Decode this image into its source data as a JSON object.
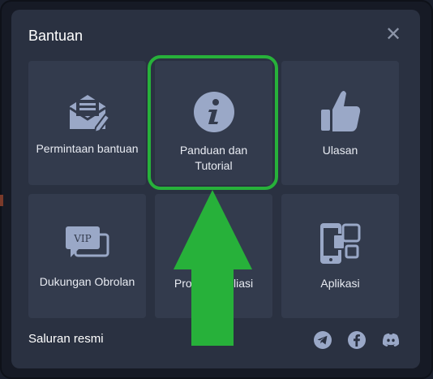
{
  "modal": {
    "title": "Bantuan",
    "close_icon": "close-icon"
  },
  "tiles": [
    {
      "label": "Permintaan bantuan",
      "icon": "envelope-pencil-icon"
    },
    {
      "label": "Panduan dan Tutorial",
      "icon": "info-icon"
    },
    {
      "label": "Ulasan",
      "icon": "thumbs-up-icon"
    },
    {
      "label": "Dukungan Obrolan",
      "icon": "vip-chat-icon"
    },
    {
      "label": "Program Afiliasi",
      "icon": "affiliate-icon"
    },
    {
      "label": "Aplikasi",
      "icon": "mobile-apps-icon"
    }
  ],
  "vip_badge": "VIP",
  "footer": {
    "label": "Saluran resmi",
    "channels": [
      "telegram-icon",
      "facebook-icon",
      "discord-icon"
    ]
  },
  "annotation": {
    "highlight_color": "#27b13a"
  },
  "colors": {
    "modal_bg": "#2a3141",
    "tile_bg": "#333b4d",
    "icon_color": "#9aa8c7",
    "text": "#ffffff"
  }
}
